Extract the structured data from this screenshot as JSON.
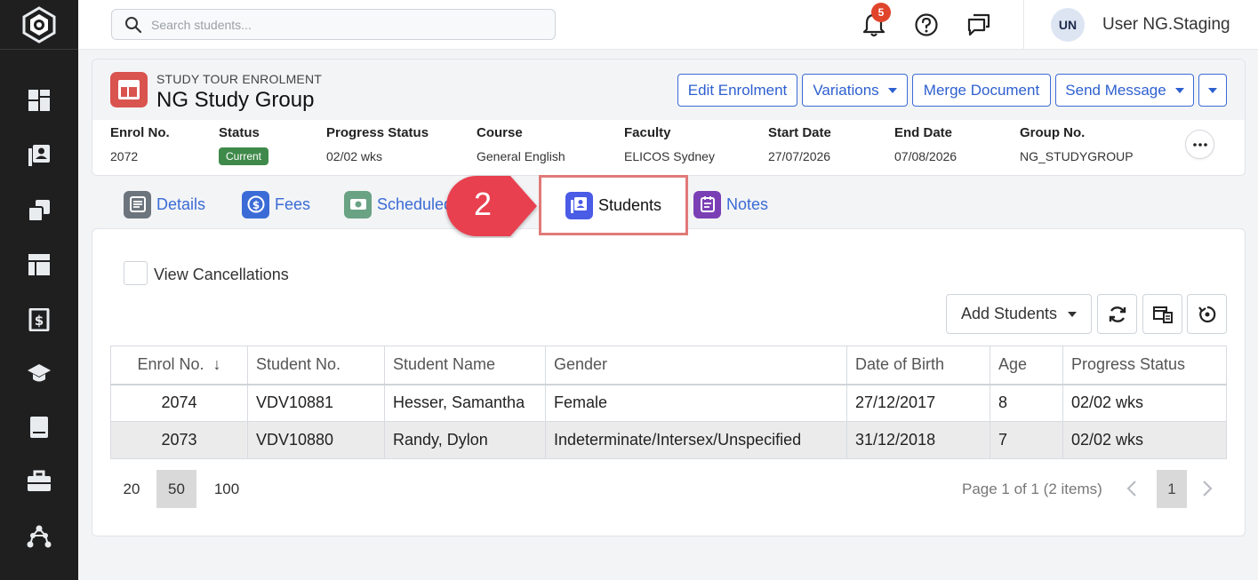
{
  "search": {
    "placeholder": "Search students..."
  },
  "topbar": {
    "notification_count": "5",
    "avatar_initials": "UN",
    "username": "User NG.Staging"
  },
  "header": {
    "subtitle": "STUDY TOUR ENROLMENT",
    "title": "NG Study Group",
    "buttons": {
      "edit": "Edit Enrolment",
      "variations": "Variations",
      "merge": "Merge Document",
      "send": "Send Message"
    }
  },
  "info": {
    "enrol_no": {
      "label": "Enrol No.",
      "value": "2072"
    },
    "status": {
      "label": "Status",
      "value": "Current"
    },
    "progress": {
      "label": "Progress Status",
      "value": "02/02 wks"
    },
    "course": {
      "label": "Course",
      "value": "General English"
    },
    "faculty": {
      "label": "Faculty",
      "value": "ELICOS Sydney"
    },
    "start": {
      "label": "Start Date",
      "value": "27/07/2026"
    },
    "end": {
      "label": "End Date",
      "value": "07/08/2026"
    },
    "group": {
      "label": "Group No.",
      "value": "NG_STUDYGROUP"
    }
  },
  "tabs": {
    "details": "Details",
    "fees": "Fees",
    "scheduled": "Scheduled",
    "students": "Students",
    "notes": "Notes"
  },
  "callout": {
    "number": "2"
  },
  "panel": {
    "view_cancellations": "View Cancellations",
    "add_students": "Add Students"
  },
  "table": {
    "headers": {
      "enrol_no": "Enrol No.",
      "student_no": "Student No.",
      "student_name": "Student Name",
      "gender": "Gender",
      "dob": "Date of Birth",
      "age": "Age",
      "progress": "Progress Status"
    },
    "rows": [
      {
        "enrol_no": "2074",
        "student_no": "VDV10881",
        "student_name": "Hesser, Samantha",
        "gender": "Female",
        "dob": "27/12/2017",
        "age": "8",
        "progress": "02/02 wks"
      },
      {
        "enrol_no": "2073",
        "student_no": "VDV10880",
        "student_name": "Randy, Dylon",
        "gender": "Indeterminate/Intersex/Unspecified",
        "dob": "31/12/2018",
        "age": "7",
        "progress": "02/02 wks"
      }
    ]
  },
  "pager": {
    "sizes": [
      "20",
      "50",
      "100"
    ],
    "selected_size": "50",
    "info": "Page 1 of 1 (2 items)",
    "current_page": "1"
  },
  "colors": {
    "sidebar": "#1f1f1f",
    "link": "#3b6bd6",
    "status_current": "#3f8a4a",
    "callout": "#e8414f",
    "highlight_border": "#e07a78"
  }
}
